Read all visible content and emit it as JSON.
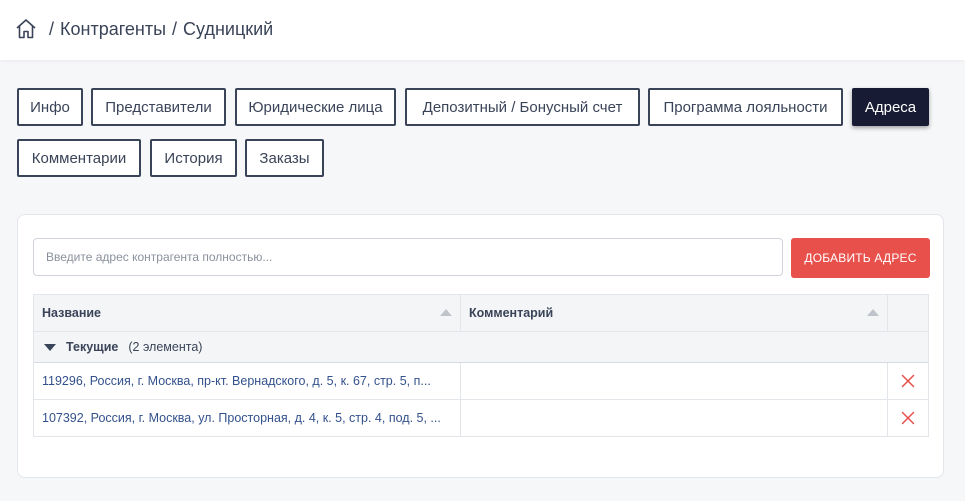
{
  "breadcrumb": {
    "home_icon": "home-icon",
    "separator": "/",
    "items": [
      "Контрагенты",
      "Судницкий"
    ]
  },
  "tabs": [
    {
      "label": "Инфо",
      "active": false
    },
    {
      "label": "Представители",
      "active": false
    },
    {
      "label": "Юридические лица",
      "active": false
    },
    {
      "label": "Депозитный / Бонусный счет",
      "active": false
    },
    {
      "label": "Программа лояльности",
      "active": false
    },
    {
      "label": "Адреса",
      "active": true
    },
    {
      "label": "Комментарии",
      "active": false
    },
    {
      "label": "История",
      "active": false
    },
    {
      "label": "Заказы",
      "active": false
    }
  ],
  "address_input": {
    "placeholder": "Введите адрес контрагента полностью...",
    "value": ""
  },
  "add_button": {
    "label": "ДОБАВИТЬ АДРЕС"
  },
  "table": {
    "columns": [
      "Название",
      "Комментарий"
    ],
    "group": {
      "label": "Текущие",
      "count": "(2 элемента)"
    },
    "rows": [
      {
        "name": "119296, Россия, г. Москва, пр-кт. Вернадского, д. 5, к. 67, стр. 5, п...",
        "comment": ""
      },
      {
        "name": "107392, Россия, г. Москва, ул. Просторная, д. 4, к. 5, стр. 4, под. 5, ...",
        "comment": ""
      }
    ]
  },
  "colors": {
    "accent": "#e8504b",
    "active_tab": "#171b33",
    "tab_border": "#3a4458",
    "link": "#33518c",
    "delete_icon": "#e8504b"
  }
}
